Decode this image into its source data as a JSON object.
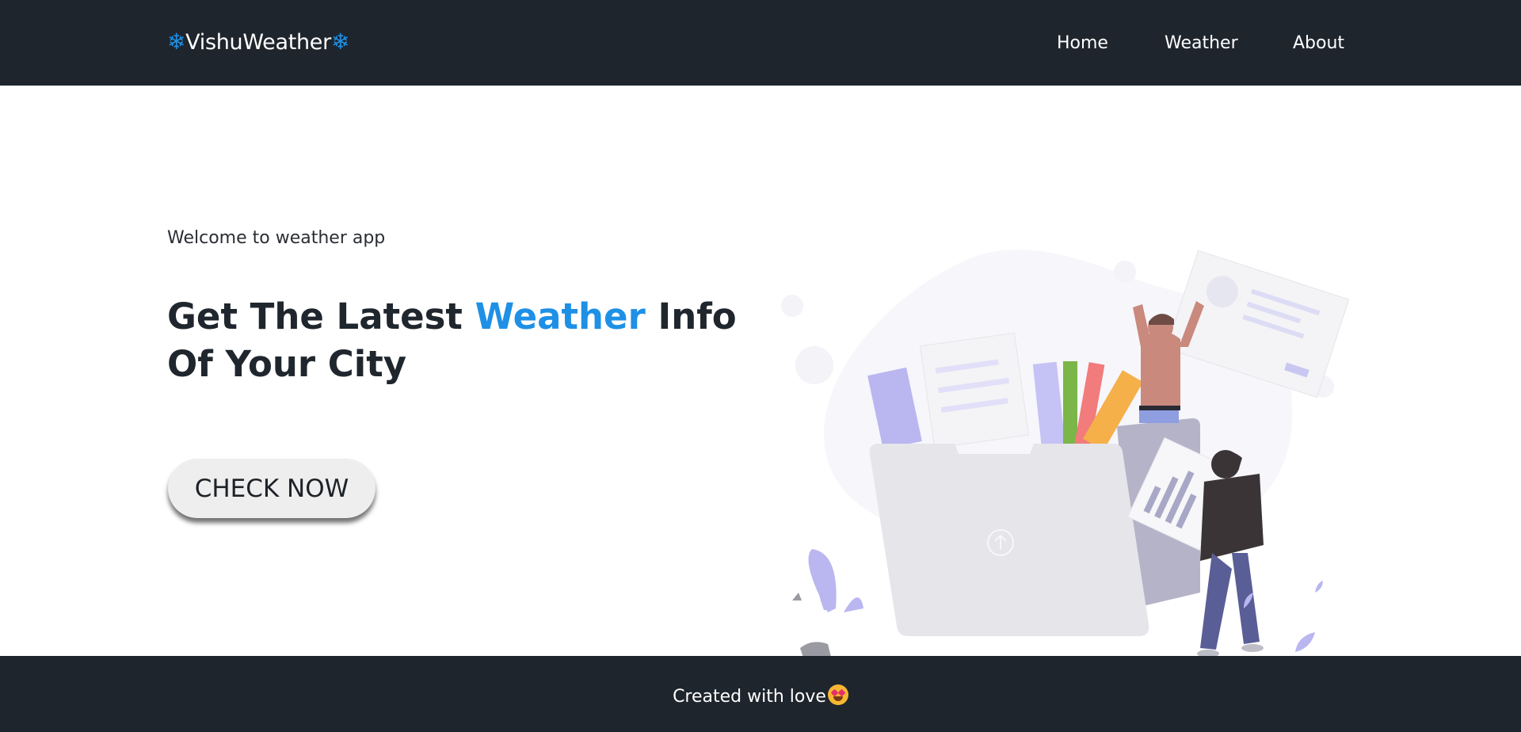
{
  "navbar": {
    "brand": "VishuWeather",
    "brand_icon": "snowflake-icon",
    "brand_accent_color": "#1e90e6",
    "links": [
      {
        "label": "Home"
      },
      {
        "label": "Weather"
      },
      {
        "label": "About"
      }
    ]
  },
  "hero": {
    "welcome": "Welcome to weather app",
    "headline_pre": "Get The Latest ",
    "headline_accent": "Weather",
    "headline_post": " Info Of Your City",
    "cta_label": "CHECK NOW",
    "illustration_icon": "upload-folder-illustration"
  },
  "footer": {
    "text": "Created with love",
    "emoji_icon": "heart-eyes-emoji-icon"
  },
  "colors": {
    "dark_bar": "#1f252d",
    "accent": "#1e90e6"
  }
}
